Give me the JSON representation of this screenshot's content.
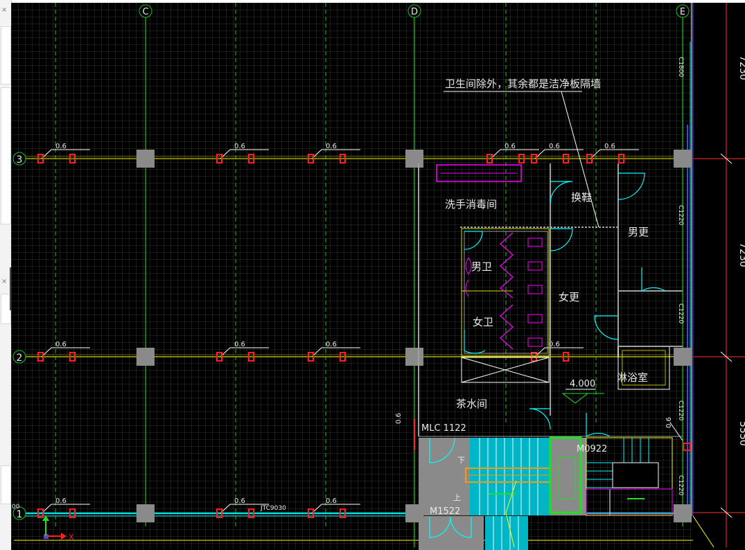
{
  "app": {
    "panel_close_glyph": "×",
    "collapse_glyph": "‹"
  },
  "axes": {
    "columns": [
      {
        "label": "C"
      },
      {
        "label": "D"
      },
      {
        "label": "E"
      }
    ],
    "rows": [
      {
        "label": "3"
      },
      {
        "label": "2"
      },
      {
        "label": "1"
      }
    ],
    "dims_right": [
      "7230",
      "7230",
      "5550"
    ],
    "left_edge_tag": "00"
  },
  "annotation": {
    "leader_text": "卫生间除外，其余都是洁净板隔墙"
  },
  "rooms": {
    "wash_disinfect": "洗手消毒间",
    "change_shoes": "换鞋",
    "men_changing": "男更",
    "men_toilet": "男卫",
    "women_changing": "女更",
    "women_toilet": "女卫",
    "shower": "淋浴室",
    "tea_room": "茶水间",
    "down": "下",
    "up": "上"
  },
  "tags": {
    "beam": "0.6",
    "elevation": "4.000",
    "door_mlc": "MLC 1122",
    "door_m0922": "M0922",
    "door_m1522": "M1522",
    "window_jtc": "JTC9030",
    "vert_0.6": "0.6",
    "side_c1": "C1800",
    "side_c2": "C1220",
    "side_c3": "C1220",
    "side_c4": "C1220",
    "side_c5": "C1220"
  },
  "ucs": {
    "x": "X",
    "y": "Y"
  },
  "colors": {
    "background": "#000000",
    "grid": "#6e6e6e",
    "axis_line": "#20c020",
    "beam_line": "#c8c800",
    "column": "#8a8a8a",
    "red_tag": "#ff2020",
    "text": "#e8e8e8",
    "cyan": "#00ffff",
    "magenta": "#ff00ff",
    "orange": "#ff9900",
    "yellow": "#ffff00",
    "stair_fill": "#00b0c0"
  }
}
